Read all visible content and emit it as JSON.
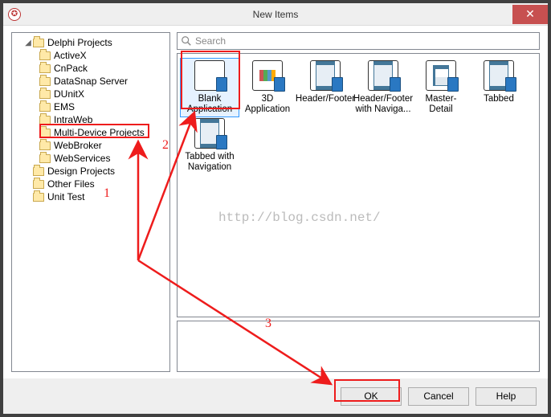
{
  "window": {
    "title": "New Items"
  },
  "tree": {
    "root": "Delphi Projects",
    "children": [
      "ActiveX",
      "CnPack",
      "DataSnap Server",
      "DUnitX",
      "EMS",
      "IntraWeb",
      "Multi-Device Projects",
      "WebBroker",
      "WebServices"
    ],
    "siblings": [
      "Design Projects",
      "Other Files",
      "Unit Test"
    ]
  },
  "search": {
    "placeholder": "Search"
  },
  "gallery": {
    "items": [
      {
        "label": "Blank Application"
      },
      {
        "label": "3D Application"
      },
      {
        "label": "Header/Footer"
      },
      {
        "label": "Header/Footer with Naviga..."
      },
      {
        "label": "Master-Detail"
      },
      {
        "label": "Tabbed"
      },
      {
        "label": "Tabbed with Navigation"
      }
    ]
  },
  "buttons": {
    "ok": "OK",
    "cancel": "Cancel",
    "help": "Help"
  },
  "annotations": {
    "n1": "1",
    "n2": "2",
    "n3": "3"
  },
  "watermark": "http://blog.csdn.net/"
}
